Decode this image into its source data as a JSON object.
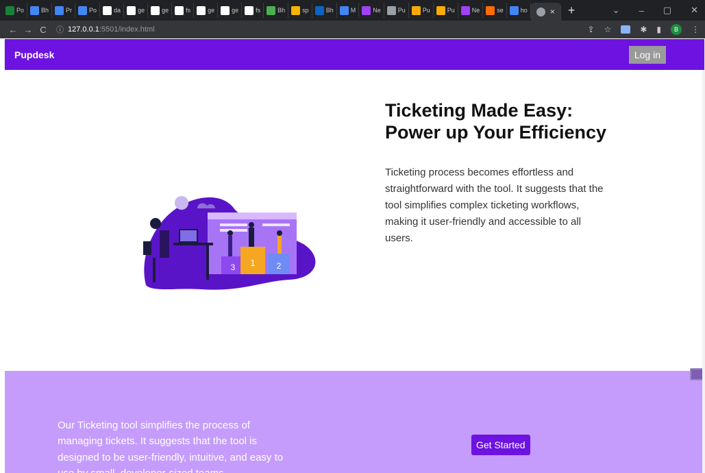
{
  "browser": {
    "tabs": [
      {
        "label": "Po",
        "color": "#188038"
      },
      {
        "label": "Bh",
        "color": "#4285f4"
      },
      {
        "label": "Pr",
        "color": "#4285f4"
      },
      {
        "label": "Po",
        "color": "#4285f4"
      },
      {
        "label": "da",
        "color": "#ffffff"
      },
      {
        "label": "ge",
        "color": "#ffffff"
      },
      {
        "label": "ge",
        "color": "#ffffff"
      },
      {
        "label": "fs",
        "color": "#ffffff"
      },
      {
        "label": "ge",
        "color": "#ffffff"
      },
      {
        "label": "ge",
        "color": "#ffffff"
      },
      {
        "label": "fs",
        "color": "#ffffff"
      },
      {
        "label": "Bh",
        "color": "#4caf50"
      },
      {
        "label": "sp",
        "color": "#f4b400"
      },
      {
        "label": "Bh",
        "color": "#0a66c2"
      },
      {
        "label": "M",
        "color": "#4285f4"
      },
      {
        "label": "Ne",
        "color": "#a142f4"
      },
      {
        "label": "Pu",
        "color": "#9aa0a6"
      },
      {
        "label": "Pu",
        "color": "#f9ab00"
      },
      {
        "label": "Pu",
        "color": "#f9ab00"
      },
      {
        "label": "Ne",
        "color": "#a142f4"
      },
      {
        "label": "se",
        "color": "#ff6d00"
      },
      {
        "label": "ho",
        "color": "#4285f4"
      }
    ],
    "active_tab_close": "×",
    "new_tab": "+",
    "window_controls": [
      "⌄",
      "–",
      "▢",
      "✕"
    ],
    "nav": {
      "back": "←",
      "forward": "→",
      "reload": "C"
    },
    "url_host": "127.0.0.1",
    "url_rest": ":5501/index.html",
    "url_info_icon": "ⓘ",
    "profile_initial": "B"
  },
  "navbar": {
    "brand": "Pupdesk",
    "login_label": "Log in"
  },
  "hero": {
    "title_line1": "Ticketing Made Easy:",
    "title_line2": "Power up Your Efficiency",
    "description": "Ticketing process becomes effortless and straightforward with the tool. It suggests that the tool simplifies complex ticketing workflows, making it user-friendly and accessible to all users.",
    "podium": {
      "first": "1",
      "second": "2",
      "third": "3"
    }
  },
  "band": {
    "text": "Our Ticketing tool simplifies the process of managing tickets. It suggests that the tool is designed to be user-friendly, intuitive, and easy to use by small, developer-sized teams",
    "cta_label": "Get Started"
  },
  "colors": {
    "brand_purple": "#6d12e0",
    "band_lilac": "#c59cfc",
    "login_gray": "#9a9a9a"
  }
}
